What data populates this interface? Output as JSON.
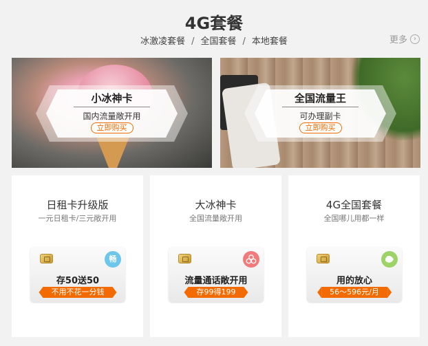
{
  "header": {
    "title": "4G套餐",
    "nav": [
      "冰激凌套餐",
      "全国套餐",
      "本地套餐"
    ],
    "separator": "/",
    "more_label": "更多",
    "more_icon": "chevron-right-circle-icon"
  },
  "banners": [
    {
      "title": "小冰神卡",
      "subtitle": "国内流量敞开用",
      "button": "立即购买"
    },
    {
      "title": "全国流量王",
      "subtitle": "可办理副卡",
      "button": "立即购买"
    }
  ],
  "cards": [
    {
      "title": "日租卡升级版",
      "subtitle": "一元日租卡/三元敞开用",
      "badge": "畅",
      "badge_color": "#6ec6ea",
      "main": "存50送50",
      "tag": "不用不花一分钱"
    },
    {
      "title": "大冰神卡",
      "subtitle": "全国流量敞开用",
      "badge": "",
      "badge_color": "#f27a7a",
      "main": "流量通话敞开用",
      "tag": "存99得199"
    },
    {
      "title": "4G全国套餐",
      "subtitle": "全国哪儿用都一样",
      "badge": "",
      "badge_color": "#9ed36a",
      "main": "用的放心",
      "tag": "56～596元/月"
    }
  ],
  "colors": {
    "accent": "#f36b00",
    "background": "#f2f2f2"
  }
}
